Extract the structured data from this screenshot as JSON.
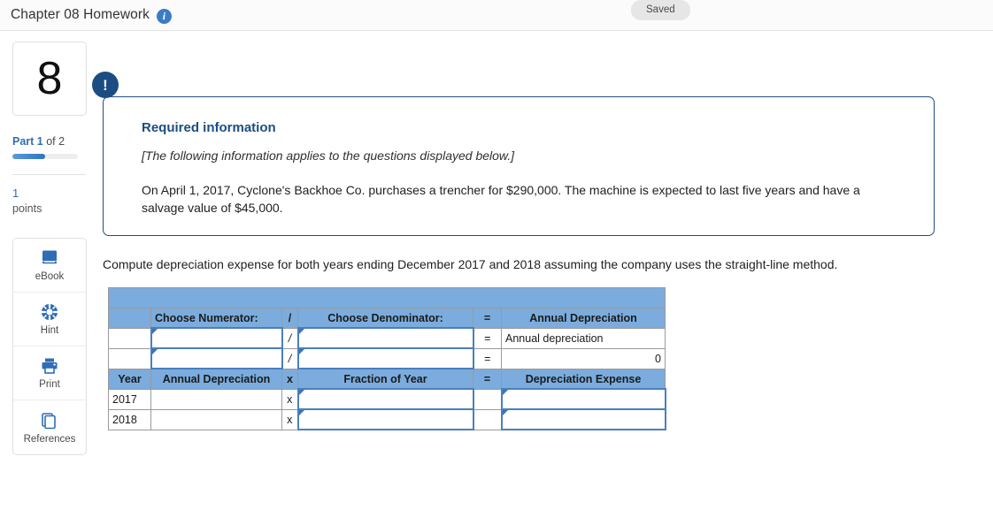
{
  "header": {
    "title": "Chapter 08 Homework",
    "info_icon": "info-icon",
    "saved_label": "Saved"
  },
  "rail": {
    "question_number": "8",
    "part_prefix": "Part 1",
    "part_suffix": " of 2",
    "progress_percent": 50,
    "points_value": "1",
    "points_word": "points",
    "tools": [
      {
        "label": "eBook",
        "icon": "ebook-icon"
      },
      {
        "label": "Hint",
        "icon": "lifebuoy-icon"
      },
      {
        "label": "Print",
        "icon": "printer-icon"
      },
      {
        "label": "References",
        "icon": "copy-pages-icon"
      }
    ]
  },
  "required_box": {
    "badge": "!",
    "title": "Required information",
    "italic_note": "[The following information applies to the questions displayed below.]",
    "body": "On April 1, 2017, Cyclone's Backhoe Co. purchases a trencher for $290,000. The machine is expected to last five years and have a salvage value of $45,000."
  },
  "prompt": "Compute depreciation expense for both years ending December 2017 and 2018 assuming the company uses the straight-line method.",
  "worksheet": {
    "header_row": {
      "corner": "",
      "numerator": "Choose Numerator:",
      "slash": "/",
      "denominator": "Choose Denominator:",
      "equals": "=",
      "result": "Annual Depreciation"
    },
    "formula_rows": [
      {
        "label": "",
        "numerator_value": "",
        "operator": "/",
        "denominator_value": "",
        "equals": "=",
        "result_value": "Annual depreciation",
        "result_align": "left",
        "result_is_input": false
      },
      {
        "label": "",
        "numerator_value": "",
        "operator": "/",
        "denominator_value": "",
        "equals": "=",
        "result_value": "0",
        "result_align": "right",
        "result_is_input": false
      }
    ],
    "year_header_row": {
      "year": "Year",
      "annual_depreciation": "Annual Depreciation",
      "times": "x",
      "fraction_of_year": "Fraction of Year",
      "equals": "=",
      "depreciation_expense": "Depreciation Expense"
    },
    "year_rows": [
      {
        "year": "2017",
        "annual_depreciation": "",
        "times": "x",
        "fraction": "",
        "equals": "",
        "expense": ""
      },
      {
        "year": "2018",
        "annual_depreciation": "",
        "times": "x",
        "fraction": "",
        "equals": "",
        "expense": ""
      }
    ]
  },
  "colors": {
    "header_blue": "#7bacdd",
    "accent_blue": "#2f6db5",
    "box_border": "#1f4e86",
    "badge_navy": "#1c4d82"
  }
}
